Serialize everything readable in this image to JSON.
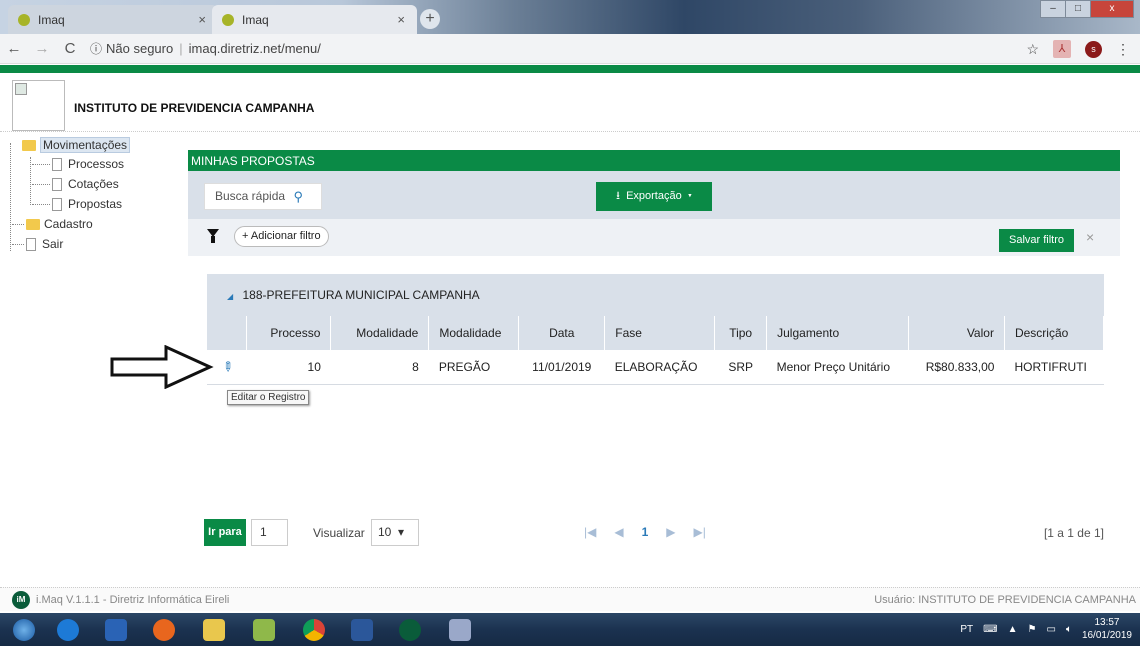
{
  "browser": {
    "tabs": [
      {
        "title": "Imaq",
        "close": "×"
      },
      {
        "title": "Imaq",
        "close": "×"
      }
    ],
    "new_tab": "+",
    "nav": {
      "back": "←",
      "forward": "→",
      "reload": "C"
    },
    "security": "Não seguro",
    "url": "imaq.diretriz.net/menu/",
    "avatar_letter": "s",
    "window_controls": {
      "min": "–",
      "max": "□",
      "close": "x"
    }
  },
  "app": {
    "institution": "INSTITUTO DE PREVIDENCIA CAMPANHA"
  },
  "sidebar": {
    "items": [
      {
        "label": "Movimentações",
        "type": "folder",
        "active": true
      },
      {
        "label": "Processos",
        "type": "file"
      },
      {
        "label": "Cotações",
        "type": "file"
      },
      {
        "label": "Propostas",
        "type": "file"
      },
      {
        "label": "Cadastro",
        "type": "folder"
      },
      {
        "label": "Sair",
        "type": "file"
      }
    ]
  },
  "panel": {
    "title": "MINHAS PROPOSTAS",
    "search_placeholder": "Busca rápida",
    "export_label": "Exportação",
    "add_filter_label": "+ Adicionar filtro",
    "save_filter_label": "Salvar filtro",
    "close_filter": "×",
    "group_title": "188-PREFEITURA MUNICIPAL CAMPANHA",
    "columns": [
      "",
      "Processo",
      "Modalidade",
      "Modalidade",
      "Data",
      "Fase",
      "Tipo",
      "Julgamento",
      "Valor",
      "Descrição"
    ],
    "rows": [
      {
        "processo": "10",
        "modalidade_num": "8",
        "modalidade": "PREGÃO",
        "data": "11/01/2019",
        "fase": "ELABORAÇÃO",
        "tipo": "SRP",
        "julgamento": "Menor Preço Unitário",
        "valor": "R$80.833,00",
        "descricao": "HORTIFRUTI"
      }
    ],
    "tooltip": "Editar o Registro",
    "pager": {
      "go_label": "Ir para",
      "page_value": "1",
      "view_label": "Visualizar",
      "per_page": "10",
      "current_page": "1",
      "range_text": "[1 a 1 de 1]"
    }
  },
  "footer": {
    "logo_text": "iM",
    "version": "i.Maq V.1.1.1 - Diretriz Informática Eireli",
    "user": "Usuário: INSTITUTO DE PREVIDENCIA CAMPANHA"
  },
  "taskbar": {
    "lang": "PT",
    "time": "13:57",
    "date": "16/01/2019"
  }
}
